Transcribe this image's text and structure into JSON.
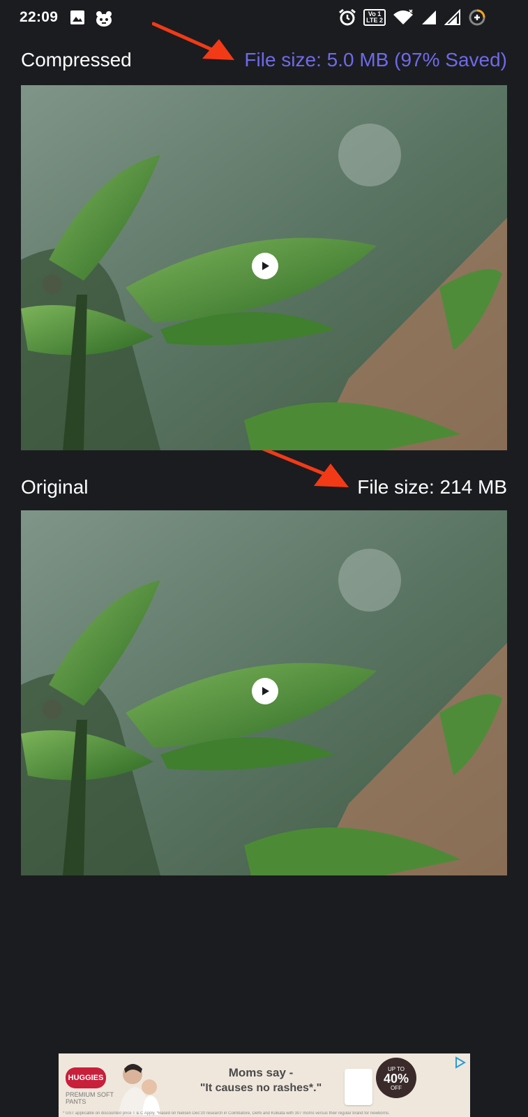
{
  "status_bar": {
    "time": "22:09",
    "lte_line1": "Vo 1",
    "lte_line2": "LTE 2",
    "icons": [
      "gallery-icon",
      "app-notification-icon",
      "alarm-icon",
      "volte-icon",
      "wifi-icon",
      "signal-icon",
      "signal-icon",
      "data-saver-icon"
    ]
  },
  "compressed": {
    "label": "Compressed",
    "size_text": "File size: 5.0 MB (97% Saved)",
    "size_color": "#6f6ae8"
  },
  "original": {
    "label": "Original",
    "size_text": "File size: 214 MB"
  },
  "ad": {
    "brand": "HUGGIES",
    "brand_sub": "PREMIUM SOFT PANTS",
    "headline_1": "Moms say -",
    "headline_2": "\"It causes no rashes*.\"",
    "offer_top": "UP TO",
    "offer_value": "40%",
    "offer_bottom": "OFF",
    "fine_print": "* GST applicable on discounted price T & C Apply. *Based on Nielsen Dec'20 research in Coimbatore, Delhi and Kolkata with 307 moms versus their regular brand for newborns."
  },
  "annotation_arrow_color": "#f23a17"
}
